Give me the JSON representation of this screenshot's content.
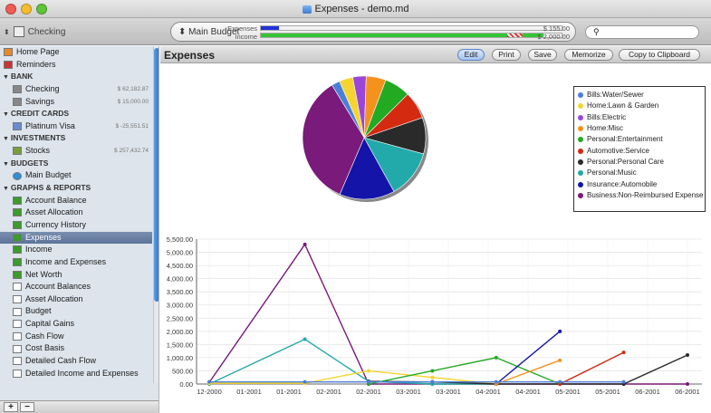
{
  "window": {
    "title": "Expenses - demo.md"
  },
  "toolbar": {
    "account_select": "Checking",
    "budget_name": "Main Budget",
    "expenses_label": "Expenses",
    "income_label": "Income",
    "expenses_value": "$ 155.00",
    "income_value": "$ 2,000.00",
    "expenses_fraction": 0.06,
    "income_fraction": 0.94
  },
  "sidebar": {
    "items": [
      {
        "label": "Home Page",
        "type": "item",
        "icon": "house-icon"
      },
      {
        "label": "Reminders",
        "type": "item",
        "icon": "calendar-icon"
      },
      {
        "label": "BANK",
        "type": "head"
      },
      {
        "label": "Checking",
        "type": "item",
        "icon": "bank-icon",
        "amount": "$ 62,182.87"
      },
      {
        "label": "Savings",
        "type": "item",
        "icon": "bank-icon",
        "amount": "$ 15,000.00"
      },
      {
        "label": "CREDIT CARDS",
        "type": "head"
      },
      {
        "label": "Platinum Visa",
        "type": "item",
        "icon": "credit-card-icon",
        "amount": "$ -25,551.51"
      },
      {
        "label": "INVESTMENTS",
        "type": "head"
      },
      {
        "label": "Stocks",
        "type": "item",
        "icon": "stock-certificate-icon",
        "amount": "$ 257,432.74"
      },
      {
        "label": "BUDGETS",
        "type": "head"
      },
      {
        "label": "Main Budget",
        "type": "item",
        "icon": "globe-icon"
      },
      {
        "label": "GRAPHS & REPORTS",
        "type": "head"
      },
      {
        "label": "Account Balance",
        "type": "item",
        "icon": "graph-icon"
      },
      {
        "label": "Asset Allocation",
        "type": "item",
        "icon": "graph-icon"
      },
      {
        "label": "Currency History",
        "type": "item",
        "icon": "graph-icon"
      },
      {
        "label": "Expenses",
        "type": "item",
        "icon": "graph-icon",
        "selected": true
      },
      {
        "label": "Income",
        "type": "item",
        "icon": "graph-icon"
      },
      {
        "label": "Income and Expenses",
        "type": "item",
        "icon": "graph-icon"
      },
      {
        "label": "Net Worth",
        "type": "item",
        "icon": "graph-icon"
      },
      {
        "label": "Account Balances",
        "type": "item",
        "icon": "report-icon"
      },
      {
        "label": "Asset Allocation",
        "type": "item",
        "icon": "report-icon"
      },
      {
        "label": "Budget",
        "type": "item",
        "icon": "report-icon"
      },
      {
        "label": "Capital Gains",
        "type": "item",
        "icon": "report-icon"
      },
      {
        "label": "Cash Flow",
        "type": "item",
        "icon": "report-icon"
      },
      {
        "label": "Cost Basis",
        "type": "item",
        "icon": "report-icon"
      },
      {
        "label": "Detailed Cash Flow",
        "type": "item",
        "icon": "report-icon"
      },
      {
        "label": "Detailed Income and Expenses",
        "type": "item",
        "icon": "report-icon"
      }
    ],
    "add_label": "+",
    "remove_label": "−"
  },
  "main": {
    "title": "Expenses",
    "buttons": {
      "edit": "Edit",
      "print": "Print",
      "save": "Save",
      "memorize": "Memorize",
      "copy": "Copy to Clipboard"
    }
  },
  "colors": {
    "accent": "#5b84c8",
    "selection": "#6a7fa5"
  },
  "chart_data": [
    {
      "type": "pie",
      "categories": [
        "Bills:Water/Sewer",
        "Home:Lawn & Garden",
        "Bills:Electric",
        "Home:Misc",
        "Personal:Entertainment",
        "Automotive:Service",
        "Personal:Personal Care",
        "Personal:Music",
        "Insurance:Automobile",
        "Business:Non-Reimbursed Expense"
      ],
      "values": [
        2.2,
        3.6,
        3.5,
        5.2,
        6.8,
        7.2,
        9.5,
        12.7,
        14.5,
        34.8
      ],
      "colors": [
        "#4a7fd6",
        "#f5d431",
        "#9b45d9",
        "#f5921e",
        "#22aa22",
        "#d42a10",
        "#2a2a2a",
        "#22aaaa",
        "#1414a8",
        "#7a1a7a"
      ],
      "legend_position": "right"
    },
    {
      "type": "line",
      "x": [
        "12-2000",
        "01-2001",
        "01-2001",
        "02-2001",
        "02-2001",
        "03-2001",
        "03-2001",
        "04-2001",
        "04-2001",
        "05-2001",
        "05-2001",
        "06-2001",
        "06-2001"
      ],
      "ylim": [
        0,
        5500
      ],
      "yticks": [
        "0.00",
        "500.00",
        "1,000.00",
        "1,500.00",
        "2,000.00",
        "2,500.00",
        "3,000.00",
        "3,500.00",
        "4,000.00",
        "4,500.00",
        "5,000.00",
        "5,500.00"
      ],
      "grid": true,
      "series": [
        {
          "color": "#7a1a7a",
          "points": [
            [
              0,
              60
            ],
            [
              3,
              5300
            ],
            [
              5,
              0
            ],
            [
              7,
              0
            ],
            [
              9,
              0
            ],
            [
              11,
              0
            ],
            [
              13,
              0
            ],
            [
              15,
              0
            ]
          ]
        },
        {
          "color": "#22aaaa",
          "points": [
            [
              0,
              0
            ],
            [
              3,
              1700
            ],
            [
              5,
              100
            ],
            [
              7,
              0
            ],
            [
              9,
              0
            ]
          ]
        },
        {
          "color": "#f5d431",
          "points": [
            [
              0,
              30
            ],
            [
              3,
              30
            ],
            [
              5,
              500
            ],
            [
              7,
              250
            ],
            [
              9,
              0
            ]
          ]
        },
        {
          "color": "#2a2a2a",
          "points": [
            [
              5,
              100
            ],
            [
              7,
              80
            ],
            [
              9,
              0
            ],
            [
              11,
              0
            ],
            [
              13,
              0
            ],
            [
              15,
              1100
            ]
          ]
        },
        {
          "color": "#22aa22",
          "points": [
            [
              5,
              0
            ],
            [
              7,
              500
            ],
            [
              9,
              1000
            ],
            [
              11,
              0
            ]
          ]
        },
        {
          "color": "#1414a8",
          "points": [
            [
              9,
              0
            ],
            [
              11,
              2000
            ]
          ]
        },
        {
          "color": "#f5921e",
          "points": [
            [
              9,
              0
            ],
            [
              11,
              900
            ]
          ]
        },
        {
          "color": "#d42a10",
          "points": [
            [
              11,
              0
            ],
            [
              13,
              1200
            ]
          ]
        },
        {
          "color": "#4a7fd6",
          "points": [
            [
              0,
              80
            ],
            [
              3,
              80
            ],
            [
              5,
              80
            ],
            [
              7,
              80
            ],
            [
              9,
              80
            ],
            [
              11,
              80
            ],
            [
              13,
              80
            ]
          ]
        }
      ]
    }
  ]
}
